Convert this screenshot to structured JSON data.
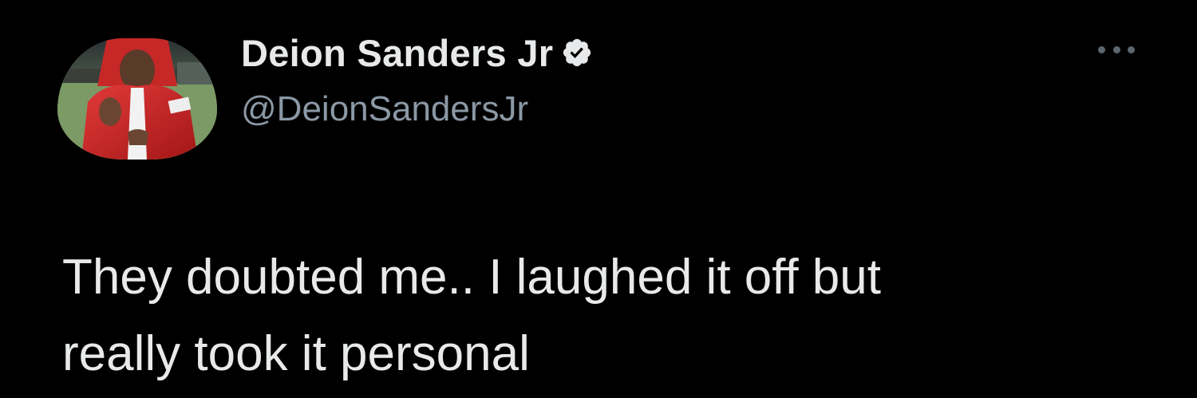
{
  "tweet": {
    "author": {
      "display_name": "Deion Sanders Jr",
      "handle": "@DeionSandersJr",
      "verified_icon": "verified-badge-icon",
      "avatar_icon": "avatar-photo"
    },
    "more_icon": "more-options-icon",
    "text_lines": [
      "They doubted me.. I laughed it off but",
      "really took it personal"
    ]
  },
  "colors": {
    "background": "#000000",
    "primary_text": "#e7e9ea",
    "secondary_text": "#8b98a5"
  }
}
